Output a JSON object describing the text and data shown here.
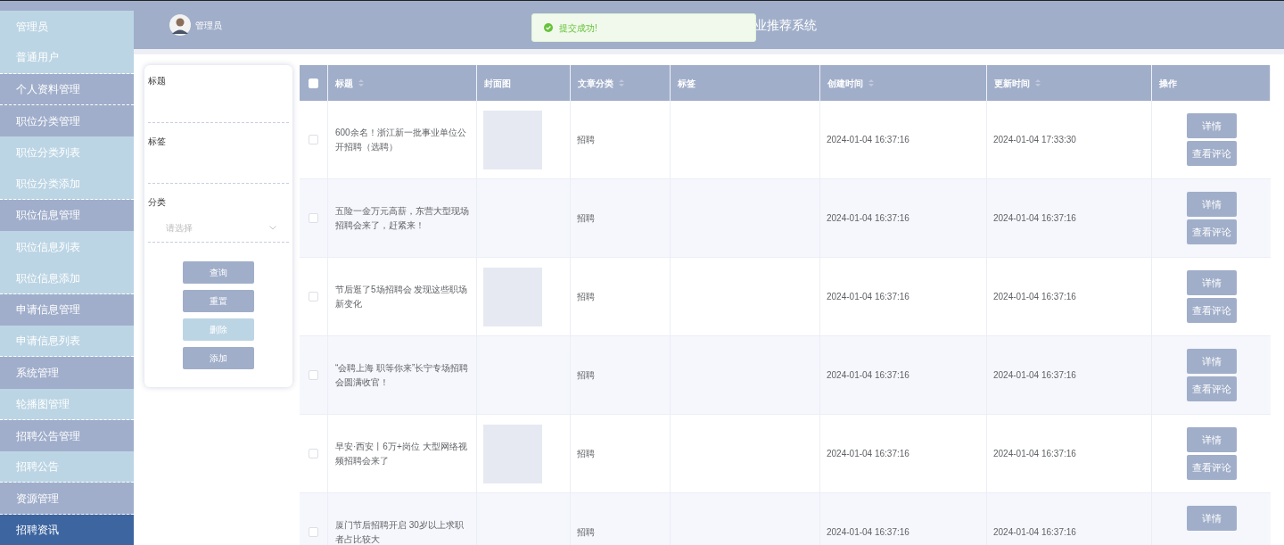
{
  "sidebar": {
    "items": [
      {
        "label": "管理员",
        "kind": "item",
        "selected": false
      },
      {
        "label": "普通用户",
        "kind": "item",
        "selected": false
      },
      {
        "label": "个人资料管理",
        "kind": "group",
        "selected": false
      },
      {
        "label": "职位分类管理",
        "kind": "group",
        "selected": false
      },
      {
        "label": "职位分类列表",
        "kind": "item",
        "selected": false
      },
      {
        "label": "职位分类添加",
        "kind": "item",
        "selected": false
      },
      {
        "label": "职位信息管理",
        "kind": "group",
        "selected": false
      },
      {
        "label": "职位信息列表",
        "kind": "item",
        "selected": false
      },
      {
        "label": "职位信息添加",
        "kind": "item",
        "selected": false
      },
      {
        "label": "申请信息管理",
        "kind": "group",
        "selected": false
      },
      {
        "label": "申请信息列表",
        "kind": "item",
        "selected": false
      },
      {
        "label": "系统管理",
        "kind": "group",
        "selected": false
      },
      {
        "label": "轮播图管理",
        "kind": "item",
        "selected": false
      },
      {
        "label": "招聘公告管理",
        "kind": "group",
        "selected": false
      },
      {
        "label": "招聘公告",
        "kind": "item",
        "selected": false
      },
      {
        "label": "资源管理",
        "kind": "group",
        "selected": false
      },
      {
        "label": "招聘资讯",
        "kind": "group",
        "selected": true
      }
    ]
  },
  "header": {
    "user": "管理员",
    "title": "业推荐系统"
  },
  "toast": {
    "message": "提交成功!"
  },
  "search": {
    "fields": [
      {
        "label": "标题",
        "kind": "input"
      },
      {
        "label": "标签",
        "kind": "input"
      },
      {
        "label": "分类",
        "kind": "select",
        "placeholder": "请选择"
      }
    ],
    "buttons": [
      {
        "label": "查询",
        "disabled": false
      },
      {
        "label": "重置",
        "disabled": false
      },
      {
        "label": "删除",
        "disabled": true
      },
      {
        "label": "添加",
        "disabled": false
      }
    ]
  },
  "table": {
    "all_checked": false,
    "columns": [
      {
        "label": "标题",
        "sortable": true
      },
      {
        "label": "封面图",
        "sortable": false
      },
      {
        "label": "文章分类",
        "sortable": true
      },
      {
        "label": "标签",
        "sortable": false
      },
      {
        "label": "创建时间",
        "sortable": true
      },
      {
        "label": "更新时间",
        "sortable": true
      },
      {
        "label": "操作",
        "sortable": false
      }
    ],
    "rows": [
      {
        "checked": false,
        "title": "600余名！浙江新一批事业单位公开招聘（选聘）",
        "cover": true,
        "category": "招聘",
        "created": "2024-01-04 16:37:16",
        "updated": "2024-01-04 17:33:30",
        "actions": [
          "详情",
          "查看评论"
        ]
      },
      {
        "checked": false,
        "title": "五险一金万元高薪，东营大型现场招聘会来了，赶紧来！",
        "cover": false,
        "category": "招聘",
        "created": "2024-01-04 16:37:16",
        "updated": "2024-01-04 16:37:16",
        "actions": [
          "详情",
          "查看评论"
        ]
      },
      {
        "checked": false,
        "title": "节后逛了5场招聘会 发现这些职场新变化",
        "cover": true,
        "category": "招聘",
        "created": "2024-01-04 16:37:16",
        "updated": "2024-01-04 16:37:16",
        "actions": [
          "详情",
          "查看评论"
        ]
      },
      {
        "checked": false,
        "title": "“会聘上海 职等你来”长宁专场招聘会圆满收官！",
        "cover": false,
        "category": "招聘",
        "created": "2024-01-04 16:37:16",
        "updated": "2024-01-04 16:37:16",
        "actions": [
          "详情",
          "查看评论"
        ]
      },
      {
        "checked": false,
        "title": "早安·西安丨6万+岗位 大型网络视频招聘会来了",
        "cover": true,
        "category": "招聘",
        "created": "2024-01-04 16:37:16",
        "updated": "2024-01-04 16:37:16",
        "actions": [
          "详情",
          "查看评论"
        ]
      },
      {
        "checked": false,
        "title": "厦门节后招聘开启 30岁以上求职者占比较大",
        "cover": false,
        "category": "招聘",
        "created": "2024-01-04 16:37:16",
        "updated": "2024-01-04 16:37:16",
        "actions": [
          "详情"
        ]
      }
    ]
  }
}
